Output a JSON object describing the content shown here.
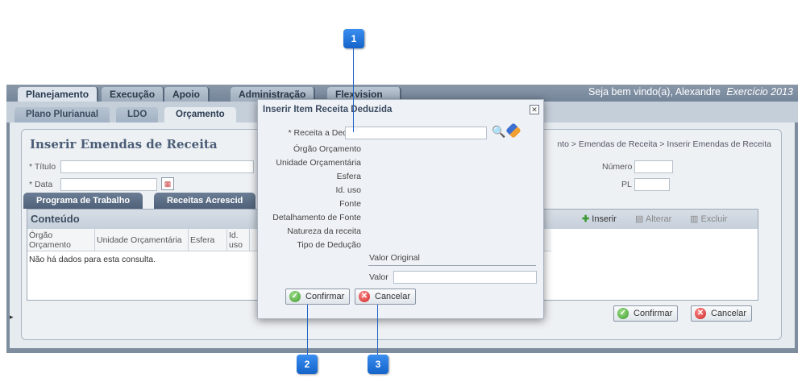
{
  "topnav": {
    "tabs": [
      "Planejamento",
      "Execução",
      "Apoio",
      "Administração",
      "Flexvision"
    ],
    "welcome": "Seja bem vindo(a), Alexandre",
    "exercise": "Exercício 2013"
  },
  "subnav": {
    "tabs": [
      "Plano Plurianual",
      "LDO",
      "Orçamento"
    ]
  },
  "page": {
    "title": "Inserir Emendas de Receita",
    "breadcrumb": "nto > Emendas de Receita > Inserir Emendas de Receita",
    "titulo_label": "* Título",
    "data_label": "* Data",
    "numero_label": "Número",
    "pl_label": "PL",
    "tabs": [
      "Programa de Trabalho",
      "Receitas Acrescid"
    ],
    "conteudo": {
      "title": "Conteúdo",
      "toolbar": {
        "insert": "Inserir",
        "edit": "Alterar",
        "delete": "Excluir"
      },
      "columns": [
        "Órgão Orçamento",
        "Unidade Orçamentária",
        "Esfera",
        "Id. uso"
      ],
      "empty": "Não há dados para esta consulta."
    },
    "confirm": "Confirmar",
    "cancel": "Cancelar"
  },
  "modal": {
    "title": "Inserir Item Receita Deduzida",
    "labels": [
      "* Receita a Deduzir",
      "Órgão Orçamento",
      "Unidade Orçamentária",
      "Esfera",
      "Id. uso",
      "Fonte",
      "Detalhamento de Fonte",
      "Natureza da receita",
      "Tipo de Dedução"
    ],
    "valor_original": "Valor Original",
    "valor_label": "Valor",
    "confirm": "Confirmar",
    "cancel": "Cancelar"
  },
  "callouts": [
    "1",
    "2",
    "3"
  ]
}
